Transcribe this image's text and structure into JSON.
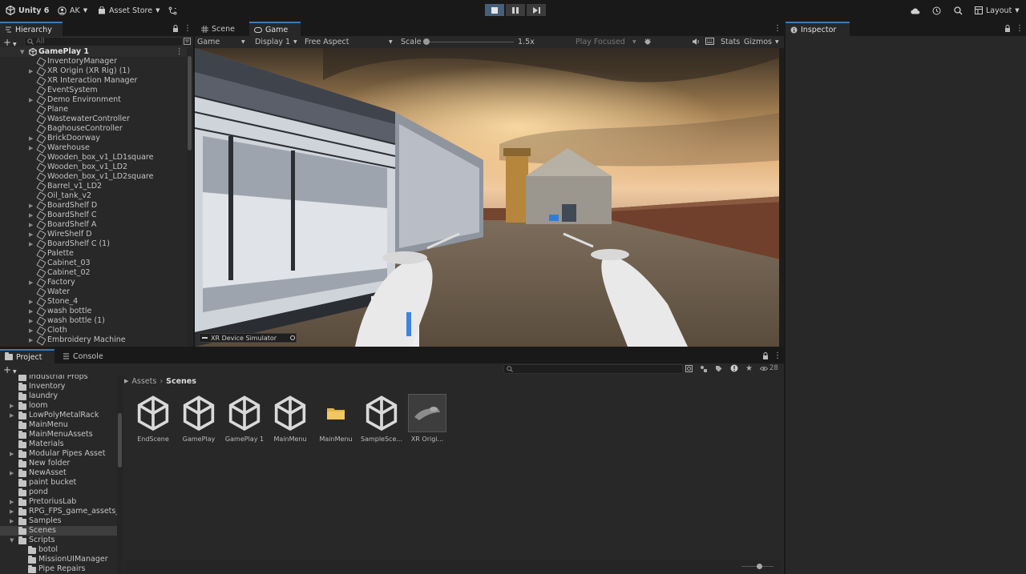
{
  "toolbar": {
    "app_title": "Unity 6",
    "account": "AK",
    "asset_store": "Asset Store",
    "layout": "Layout"
  },
  "hierarchy": {
    "tab": "Hierarchy",
    "search_placeholder": "All",
    "scene": "GamePlay 1",
    "items": [
      {
        "label": "InventoryManager",
        "expand": false
      },
      {
        "label": "XR Origin (XR Rig) (1)",
        "expand": true
      },
      {
        "label": "XR Interaction Manager",
        "expand": false
      },
      {
        "label": "EventSystem",
        "expand": false
      },
      {
        "label": "Demo Environment",
        "expand": true
      },
      {
        "label": "Plane",
        "expand": false
      },
      {
        "label": "WastewaterController",
        "expand": false
      },
      {
        "label": "BaghouseController",
        "expand": false
      },
      {
        "label": "BrickDoorway",
        "expand": true
      },
      {
        "label": "Warehouse",
        "expand": true
      },
      {
        "label": "Wooden_box_v1_LD1square",
        "expand": false
      },
      {
        "label": "Wooden_box_v1_LD2",
        "expand": false
      },
      {
        "label": "Wooden_box_v1_LD2square",
        "expand": false
      },
      {
        "label": "Barrel_v1_LD2",
        "expand": false
      },
      {
        "label": "Oil_tank_v2",
        "expand": false
      },
      {
        "label": "BoardShelf D",
        "expand": true
      },
      {
        "label": "BoardShelf C",
        "expand": true
      },
      {
        "label": "BoardShelf A",
        "expand": true
      },
      {
        "label": "WireShelf D",
        "expand": true
      },
      {
        "label": "BoardShelf C (1)",
        "expand": true
      },
      {
        "label": "Palette",
        "expand": false
      },
      {
        "label": "Cabinet_03",
        "expand": false
      },
      {
        "label": "Cabinet_02",
        "expand": false
      },
      {
        "label": "Factory",
        "expand": true
      },
      {
        "label": "Water",
        "expand": false
      },
      {
        "label": "Stone_4",
        "expand": true
      },
      {
        "label": "wash bottle",
        "expand": true
      },
      {
        "label": "wash bottle (1)",
        "expand": true
      },
      {
        "label": "Cloth",
        "expand": true
      },
      {
        "label": "Embroidery Machine",
        "expand": true
      }
    ]
  },
  "scene_tabs": {
    "scene": "Scene",
    "game": "Game"
  },
  "game_toolbar": {
    "mode": "Game",
    "display": "Display 1",
    "aspect": "Free Aspect",
    "scale_label": "Scale",
    "scale_value": "1.5x",
    "play_mode": "Play Focused",
    "stats": "Stats",
    "gizmos": "Gizmos"
  },
  "game_view": {
    "overlay_label": "XR Device Simulator",
    "inventory_slot_count": 6
  },
  "inspector": {
    "tab": "Inspector"
  },
  "bottom_tabs": {
    "project": "Project",
    "console": "Console"
  },
  "project": {
    "hidden_count": "28",
    "breadcrumb": {
      "root": "Assets",
      "current": "Scenes"
    },
    "folders": [
      {
        "label": "Industrial Props",
        "indent": 0,
        "expand": false
      },
      {
        "label": "Inventory",
        "indent": 0,
        "expand": false
      },
      {
        "label": "laundry",
        "indent": 0,
        "expand": false
      },
      {
        "label": "loom",
        "indent": 0,
        "expand": true
      },
      {
        "label": "LowPolyMetalRack",
        "indent": 0,
        "expand": true
      },
      {
        "label": "MainMenu",
        "indent": 0,
        "expand": false
      },
      {
        "label": "MainMenuAssets",
        "indent": 0,
        "expand": false
      },
      {
        "label": "Materials",
        "indent": 0,
        "expand": false
      },
      {
        "label": "Modular Pipes Asset",
        "indent": 0,
        "expand": true
      },
      {
        "label": "New folder",
        "indent": 0,
        "expand": false
      },
      {
        "label": "NewAsset",
        "indent": 0,
        "expand": true
      },
      {
        "label": "paint bucket",
        "indent": 0,
        "expand": false
      },
      {
        "label": "pond",
        "indent": 0,
        "expand": false
      },
      {
        "label": "PretoriusLab",
        "indent": 0,
        "expand": true
      },
      {
        "label": "RPG_FPS_game_assets_ir",
        "indent": 0,
        "expand": true
      },
      {
        "label": "Samples",
        "indent": 0,
        "expand": true
      },
      {
        "label": "Scenes",
        "indent": 0,
        "expand": false,
        "selected": true
      },
      {
        "label": "Scripts",
        "indent": 0,
        "expand": true,
        "open": true
      },
      {
        "label": "botol",
        "indent": 1,
        "expand": false
      },
      {
        "label": "MissionUIManager",
        "indent": 1,
        "expand": false
      },
      {
        "label": "Pipe Repairs",
        "indent": 1,
        "expand": false
      }
    ],
    "assets": [
      {
        "label": "EndScene",
        "kind": "unity"
      },
      {
        "label": "GamePlay",
        "kind": "unity"
      },
      {
        "label": "GamePlay 1",
        "kind": "unity"
      },
      {
        "label": "MainMenu",
        "kind": "unity"
      },
      {
        "label": "MainMenu",
        "kind": "folder"
      },
      {
        "label": "SampleSce...",
        "kind": "unity"
      },
      {
        "label": "XR Origi...",
        "kind": "prefab"
      }
    ]
  },
  "colors": {
    "accent": "#3a79bb",
    "panel": "#282828",
    "background": "#191919",
    "play_active": "#46607c"
  }
}
